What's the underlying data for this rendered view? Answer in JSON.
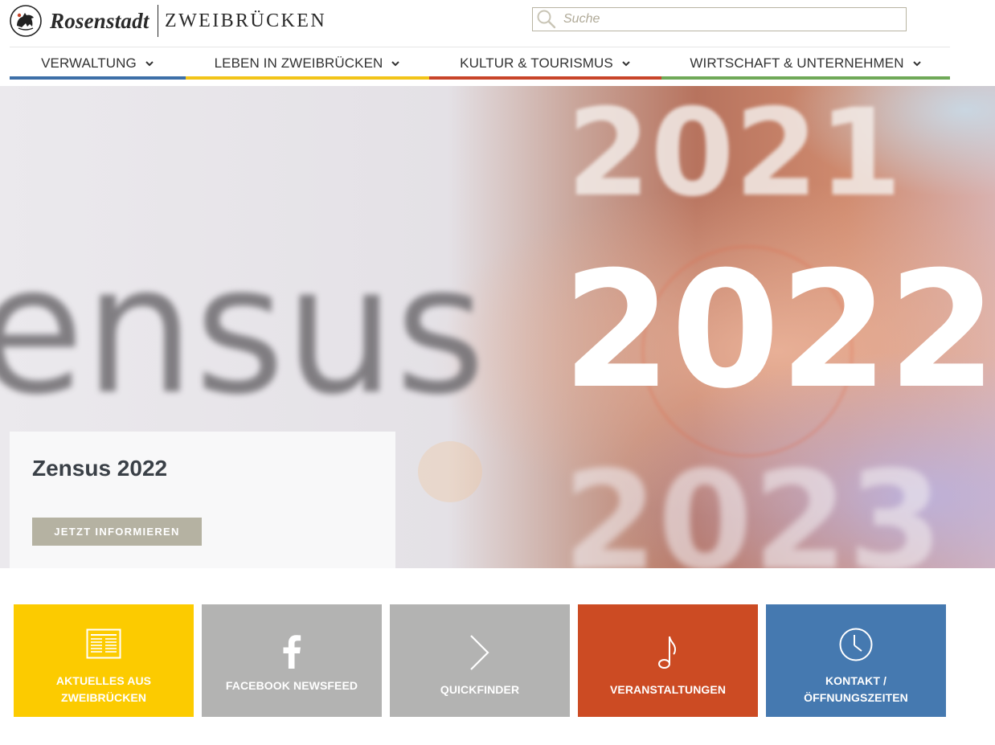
{
  "header": {
    "logo_primary": "Rosenstadt",
    "logo_secondary": "ZWEIBRÜCKEN",
    "search_placeholder": "Suche"
  },
  "nav": {
    "items": [
      {
        "label": "VERWALTUNG",
        "color": "#3d6fa8"
      },
      {
        "label": "LEBEN IN ZWEIBRÜCKEN",
        "color": "#f2c418"
      },
      {
        "label": "KULTUR & TOURISMUS",
        "color": "#c8452a"
      },
      {
        "label": "WIRTSCHAFT & UNTERNEHMEN",
        "color": "#6fa958"
      }
    ]
  },
  "hero": {
    "image_text_word": "ensus",
    "image_text_years": [
      "2021",
      "2022",
      "2023"
    ],
    "title": "Zensus 2022",
    "button_label": "JETZT INFORMIEREN"
  },
  "tiles": [
    {
      "label_line1": "AKTUELLES AUS",
      "label_line2": "ZWEIBRÜCKEN",
      "icon": "newspaper-icon",
      "color": "#fccb00"
    },
    {
      "label_line1": "FACEBOOK NEWSFEED",
      "label_line2": "",
      "icon": "facebook-icon",
      "color": "#b3b3b2"
    },
    {
      "label_line1": "QUICKFINDER",
      "label_line2": "",
      "icon": "chevron-right-icon",
      "color": "#b3b3b2"
    },
    {
      "label_line1": "VERANSTALTUNGEN",
      "label_line2": "",
      "icon": "music-note-icon",
      "color": "#cc4b23"
    },
    {
      "label_line1": "KONTAKT /",
      "label_line2": "ÖFFNUNGSZEITEN",
      "icon": "clock-icon",
      "color": "#4579b0"
    }
  ]
}
